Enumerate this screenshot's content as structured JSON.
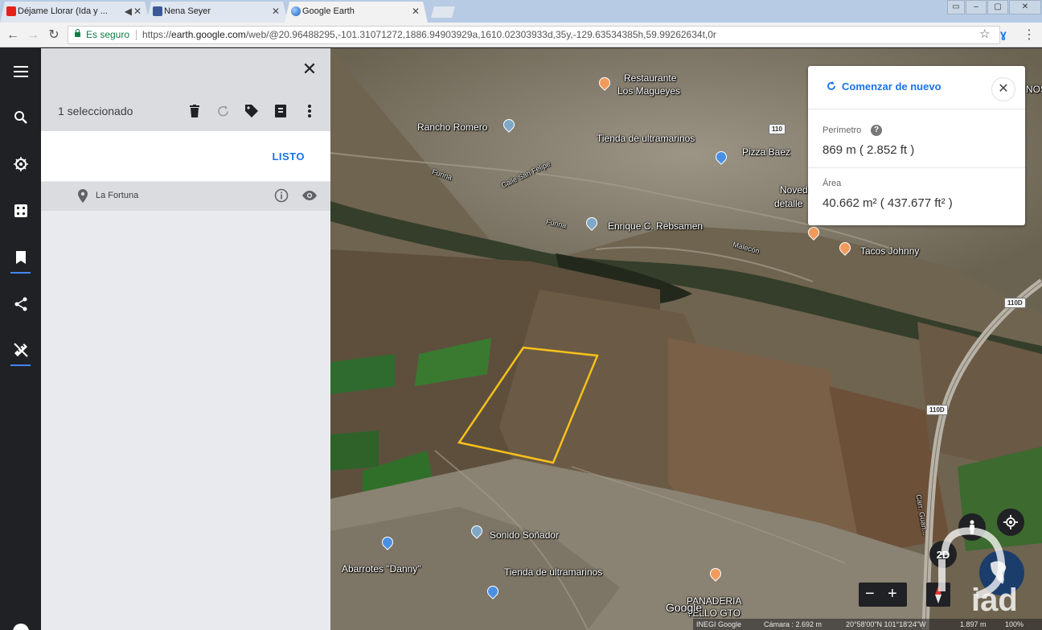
{
  "browser": {
    "tabs": [
      {
        "title": "Déjame Llorar (Ida y ...",
        "active": false
      },
      {
        "title": "Nena Seyer",
        "active": false
      },
      {
        "title": "Google Earth",
        "active": true
      }
    ],
    "secure_label": "Es seguro",
    "url_scheme": "https://",
    "url_host": "earth.google.com",
    "url_path": "/web/@20.96488295,-101.31071272,1886.94903929a,1610.02303933d,35y,-129.63534385h,59.99262634t,0r"
  },
  "panel": {
    "selected_count": "1 seleccionado",
    "done_label": "LISTO",
    "item": {
      "name": "La Fortuna"
    }
  },
  "measure": {
    "restart_label": "Comenzar de nuevo",
    "perimeter_label": "Perímetro",
    "perimeter_value": "869 m ( 2.852 ft )",
    "area_label": "Área",
    "area_value": "40.662 m² ( 437.677 ft² )"
  },
  "map_labels": {
    "restaurante": "Restaurante",
    "los_magueyes": "Los Magueyes",
    "rancho_romero": "Rancho Romero",
    "tienda1": "Tienda de ultramarinos",
    "pizza": "Pizza Baez",
    "novedades": "Noved",
    "detalles": "detalle",
    "enrique": "Enrique C. Rebsamen",
    "tacos": "Tacos Johnny",
    "sonido": "Sonido Soñador",
    "abarrotes": "Abarrotes \"Danny\"",
    "tienda2": "Tienda de ultramarinos",
    "panaderia": "PANADERIA",
    "tello": "TELLO GTO",
    "google": "Google",
    "nos": "NOS",
    "street_furina": "Furina",
    "street_sanfelipe": "Calle San Felipe",
    "street_malecon": "Malecón",
    "street_carr": "Carr. Guan...",
    "shield_110": "110",
    "shield_110d_a": "110D",
    "shield_110d_b": "110D"
  },
  "controls": {
    "mode_2d": "2D",
    "zoom_minus": "−",
    "zoom_plus": "+"
  },
  "status": {
    "credits": "INEGI Google",
    "camera": "Cámara : 2.692 m",
    "coords": "20°58'00\"N 101°18'24\"W",
    "elevation": "1.897 m",
    "zoom_pct": "100%"
  },
  "watermark": "iad",
  "colors": {
    "accent_blue": "#1a73e8",
    "polygon_outline": "#f6c11a",
    "rail_bg": "#202124",
    "panel_bg": "#e8eaed",
    "poi_orange": "#f29a5c",
    "poi_blue": "#4a90e2"
  }
}
